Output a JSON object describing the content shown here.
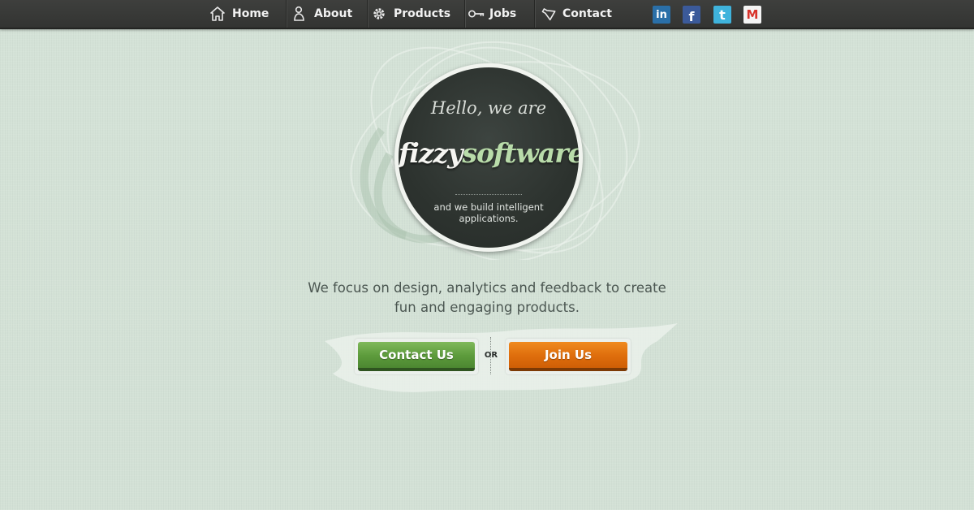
{
  "nav": {
    "items": [
      {
        "label": "Home",
        "icon": "home-icon"
      },
      {
        "label": "About",
        "icon": "person-icon"
      },
      {
        "label": "Products",
        "icon": "gear-icon"
      },
      {
        "label": "Jobs",
        "icon": "key-icon"
      },
      {
        "label": "Contact",
        "icon": "megaphone-icon"
      }
    ],
    "social": [
      {
        "icon": "linkedin-icon",
        "glyph": "in",
        "color": "#2a6fa8"
      },
      {
        "icon": "facebook-icon",
        "glyph": "f",
        "color": "#3b5a9a"
      },
      {
        "icon": "twitter-icon",
        "glyph": "t",
        "color": "#3fb3dc"
      },
      {
        "icon": "gmail-icon",
        "glyph": "M",
        "color": "#d8322a"
      }
    ]
  },
  "hero": {
    "greeting": "Hello, we are",
    "brand_part1": "fizzy",
    "brand_part2": "software",
    "tagline": "and we build intelligent applications."
  },
  "headline": {
    "line1": "We focus on design, analytics and feedback to create",
    "line2": "fun and engaging products."
  },
  "cta": {
    "contact_label": "Contact Us",
    "or_label": "OR",
    "join_label": "Join Us"
  },
  "colors": {
    "background": "#d2e0d5",
    "nav_bar": "#383937",
    "badge": "#2d332f",
    "brand_accent": "#b9dcaa",
    "contact_button": "#5c9a3b",
    "join_button": "#de6d0c"
  }
}
